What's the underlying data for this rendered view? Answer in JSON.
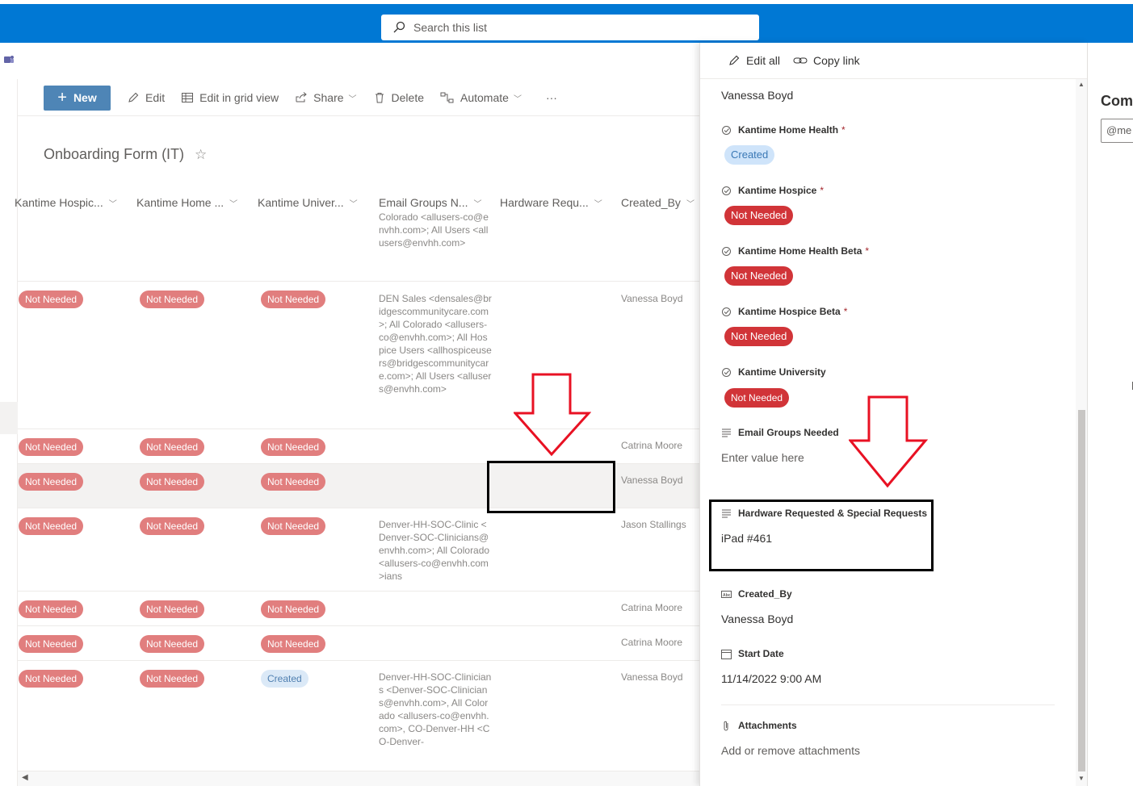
{
  "search": {
    "placeholder": "Search this list"
  },
  "toolbar": {
    "new_label": "New",
    "edit_label": "Edit",
    "grid_label": "Edit in grid view",
    "share_label": "Share",
    "delete_label": "Delete",
    "automate_label": "Automate",
    "more_label": "···"
  },
  "list": {
    "title": "Onboarding Form (IT)",
    "columns": [
      "Kantime Hospic...",
      "Kantime Home ...",
      "Kantime Univer...",
      "Email Groups N...",
      "Hardware Requ...",
      "Created_By"
    ],
    "rows": [
      {
        "p1": "",
        "p2": "",
        "p3": "",
        "email": "Colorado <allusers-co@envhh.com>; All Users <allusers@envhh.com>",
        "creator": ""
      },
      {
        "p1": "Not Needed",
        "p2": "Not Needed",
        "p3": "Not Needed",
        "email": "DEN Sales <densales@bridgescommunitycare.com>; All Colorado <allusers-co@envhh.com>; All Hospice Users <allhospiceusers@bridgescommunitycare.com>; All Users <allusers@envhh.com>",
        "creator": "Vanessa Boyd"
      },
      {
        "p1": "Not Needed",
        "p2": "Not Needed",
        "p3": "Not Needed",
        "email": "",
        "creator": "Catrina Moore"
      },
      {
        "p1": "Not Needed",
        "p2": "Not Needed",
        "p3": "Not Needed",
        "email": "",
        "creator": "Vanessa Boyd"
      },
      {
        "p1": "Not Needed",
        "p2": "Not Needed",
        "p3": "Not Needed",
        "email": "Denver-HH-SOC-Clinic <Denver-SOC-Clinicians@envhh.com>; All Colorado <allusers-co@envhh.com>ians",
        "creator": "Jason Stallings"
      },
      {
        "p1": "Not Needed",
        "p2": "Not Needed",
        "p3": "Not Needed",
        "email": "",
        "creator": "Catrina Moore"
      },
      {
        "p1": "Not Needed",
        "p2": "Not Needed",
        "p3": "Not Needed",
        "email": "",
        "creator": "Catrina Moore"
      },
      {
        "p1": "Not Needed",
        "p2": "Not Needed",
        "p3": "Created",
        "email": "Denver-HH-SOC-Clinicians <Denver-SOC-Clinicians@envhh.com>, All Colorado <allusers-co@envhh.com>, CO-Denver-HH <CO-Denver-",
        "creator": "Vanessa Boyd"
      }
    ]
  },
  "panel": {
    "edit_all_label": "Edit all",
    "copy_link_label": "Copy link",
    "top_value": "Vanessa Boyd",
    "fields": [
      {
        "label": "Kantime Home Health",
        "required": "*",
        "value": "Created"
      },
      {
        "label": "Kantime Hospice",
        "required": "*",
        "value": "Not Needed"
      },
      {
        "label": "Kantime Home Health Beta",
        "required": "*",
        "value": "Not Needed"
      },
      {
        "label": "Kantime Hospice Beta",
        "required": "*",
        "value": "Not Needed"
      },
      {
        "label": "Kantime University",
        "required": "",
        "value": "Not Needed"
      }
    ],
    "email_label": "Email Groups Needed",
    "email_value": "Enter value here",
    "hardware_label": "Hardware Requested & Special Requests",
    "hardware_value": "iPad #461",
    "createdby_label": "Created_By",
    "createdby_value": "Vanessa Boyd",
    "startdate_label": "Start Date",
    "startdate_value": "11/14/2022 9:00 AM",
    "attach_label": "Attachments",
    "attach_value": "Add or remove attachments"
  },
  "comments": {
    "title": "Comm",
    "placeholder": "@me"
  },
  "colors": {
    "brand": "#0078d4",
    "pill_red": "#d13438",
    "pill_faded": "#e17e7e",
    "annotation": "#e81123"
  }
}
